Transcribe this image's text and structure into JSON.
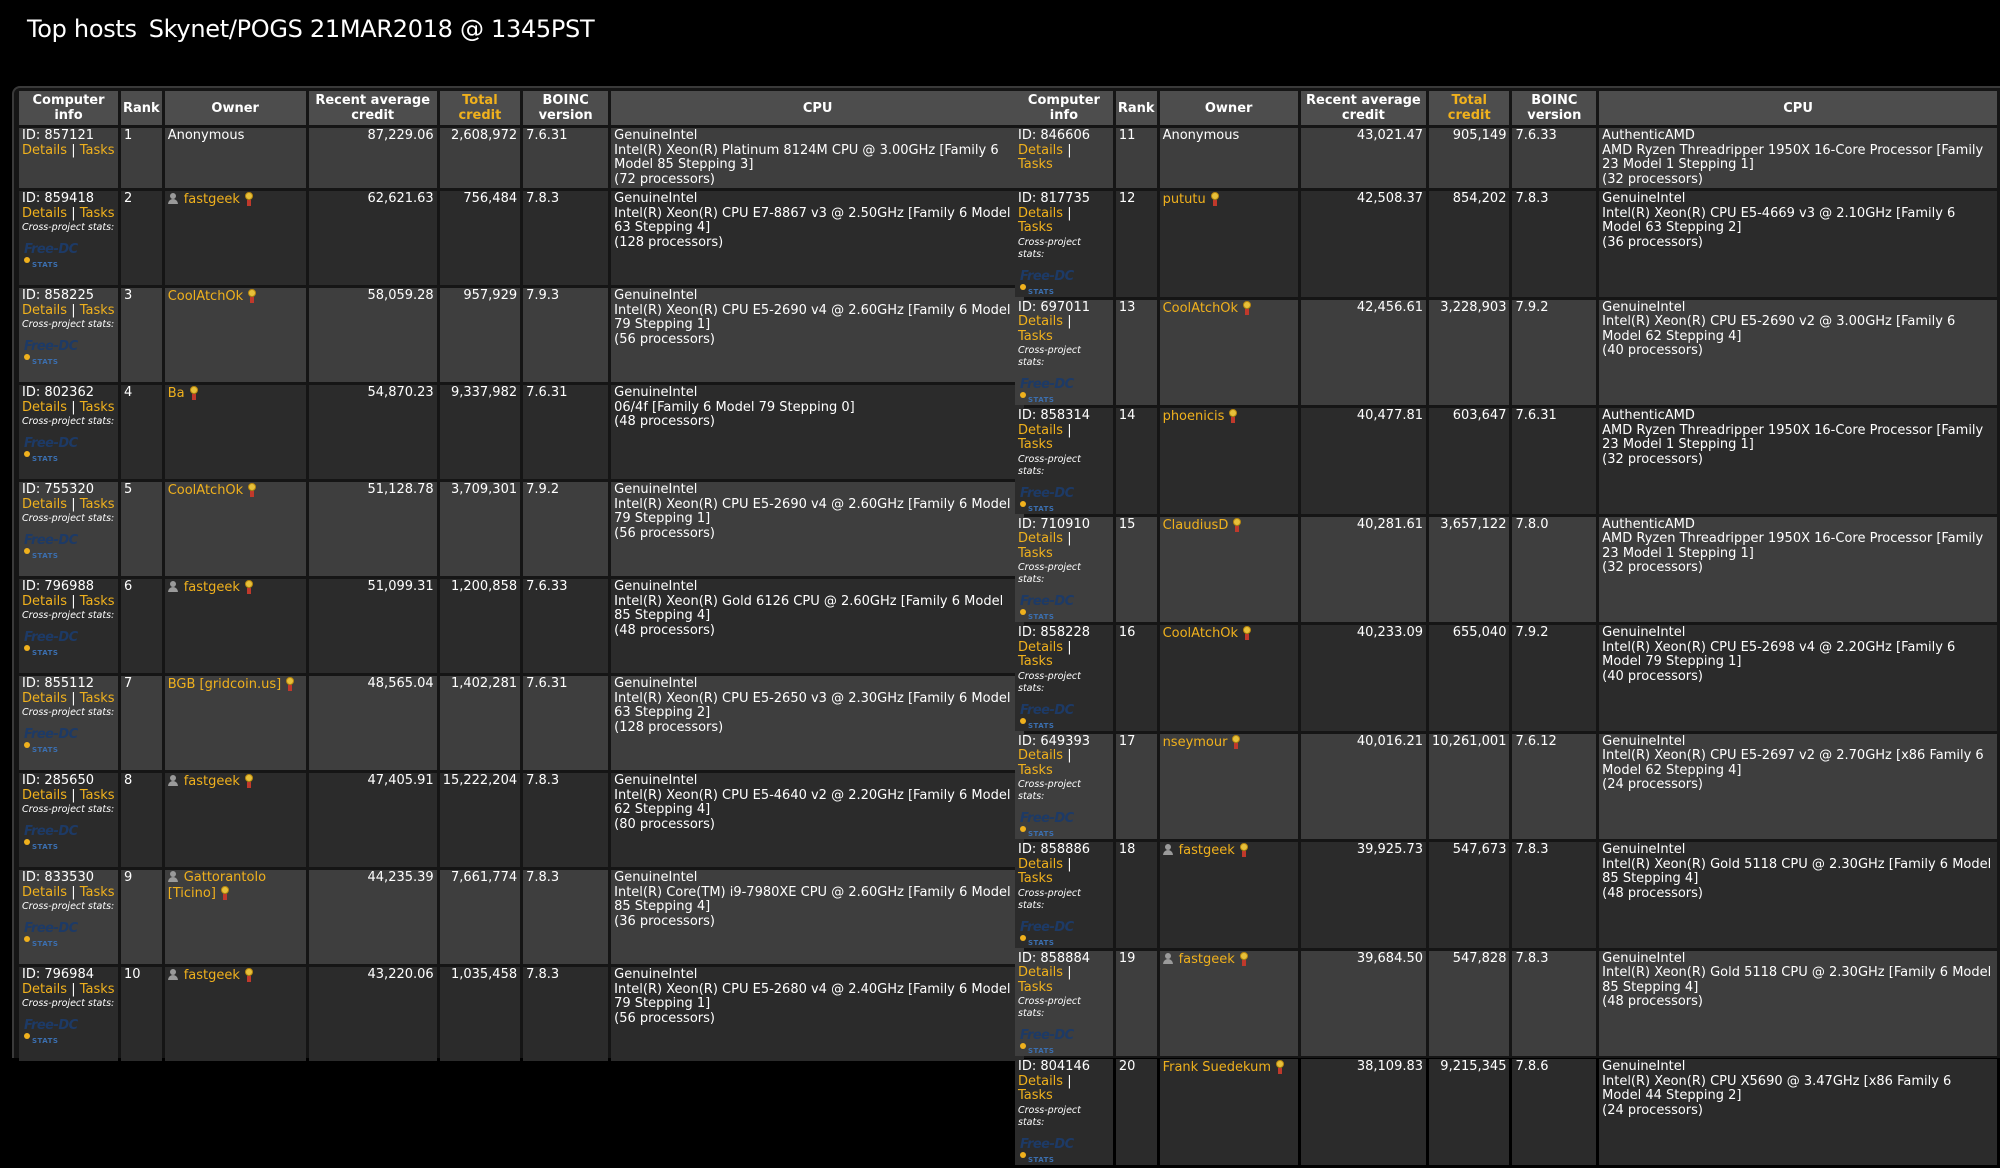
{
  "page": {
    "title": "Top hosts",
    "subtitle": "Skynet/POGS 21MAR2018 @ 1345PST"
  },
  "table": {
    "headers": [
      "Computer info",
      "Rank",
      "Owner",
      "Recent average credit",
      "Total credit",
      "BOINC version",
      "CPU"
    ],
    "details_label": "Details",
    "tasks_label": "Tasks",
    "cross_project_label": "Cross-project stats:",
    "logo_text": "Free-DC",
    "logo_sub": "STATS"
  },
  "colors": {
    "link": "#f0b11d",
    "header_bg": "#4d4d4d",
    "row_odd": "#3e3e3e",
    "row_even": "#2b2b2b"
  },
  "hosts_left": [
    {
      "id": "ID: 857121",
      "rank": "1",
      "owner": "Anonymous",
      "anon": true,
      "user_icon": false,
      "rac": "87,229.06",
      "total": "2,608,972",
      "boinc": "7.6.31",
      "cpu_vendor": "GenuineIntel",
      "cpu_model": "Intel(R) Xeon(R) Platinum 8124M CPU @ 3.00GHz [Family 6 Model 85 Stepping 3]",
      "procs": "(72 processors)"
    },
    {
      "id": "ID: 859418",
      "rank": "2",
      "owner": "fastgeek",
      "anon": false,
      "user_icon": true,
      "rac": "62,621.63",
      "total": "756,484",
      "boinc": "7.8.3",
      "cpu_vendor": "GenuineIntel",
      "cpu_model": "Intel(R) Xeon(R) CPU E7-8867 v3 @ 2.50GHz [Family 6 Model 63 Stepping 4]",
      "procs": "(128 processors)"
    },
    {
      "id": "ID: 858225",
      "rank": "3",
      "owner": "CoolAtchOk",
      "anon": false,
      "user_icon": false,
      "rac": "58,059.28",
      "total": "957,929",
      "boinc": "7.9.3",
      "cpu_vendor": "GenuineIntel",
      "cpu_model": "Intel(R) Xeon(R) CPU E5-2690 v4 @ 2.60GHz [Family 6 Model 79 Stepping 1]",
      "procs": "(56 processors)"
    },
    {
      "id": "ID: 802362",
      "rank": "4",
      "owner": "Ba",
      "anon": false,
      "user_icon": false,
      "rac": "54,870.23",
      "total": "9,337,982",
      "boinc": "7.6.31",
      "cpu_vendor": "GenuineIntel",
      "cpu_model": "06/4f [Family 6 Model 79 Stepping 0]",
      "procs": "(48 processors)"
    },
    {
      "id": "ID: 755320",
      "rank": "5",
      "owner": "CoolAtchOk",
      "anon": false,
      "user_icon": false,
      "rac": "51,128.78",
      "total": "3,709,301",
      "boinc": "7.9.2",
      "cpu_vendor": "GenuineIntel",
      "cpu_model": "Intel(R) Xeon(R) CPU E5-2690 v4 @ 2.60GHz [Family 6 Model 79 Stepping 1]",
      "procs": "(56 processors)"
    },
    {
      "id": "ID: 796988",
      "rank": "6",
      "owner": "fastgeek",
      "anon": false,
      "user_icon": true,
      "rac": "51,099.31",
      "total": "1,200,858",
      "boinc": "7.6.33",
      "cpu_vendor": "GenuineIntel",
      "cpu_model": "Intel(R) Xeon(R) Gold 6126 CPU @ 2.60GHz [Family 6 Model 85 Stepping 4]",
      "procs": "(48 processors)"
    },
    {
      "id": "ID: 855112",
      "rank": "7",
      "owner": "BGB [gridcoin.us]",
      "anon": false,
      "user_icon": false,
      "rac": "48,565.04",
      "total": "1,402,281",
      "boinc": "7.6.31",
      "cpu_vendor": "GenuineIntel",
      "cpu_model": "Intel(R) Xeon(R) CPU E5-2650 v3 @ 2.30GHz [Family 6 Model 63 Stepping 2]",
      "procs": "(128 processors)"
    },
    {
      "id": "ID: 285650",
      "rank": "8",
      "owner": "fastgeek",
      "anon": false,
      "user_icon": true,
      "rac": "47,405.91",
      "total": "15,222,204",
      "boinc": "7.8.3",
      "cpu_vendor": "GenuineIntel",
      "cpu_model": "Intel(R) Xeon(R) CPU E5-4640 v2 @ 2.20GHz [Family 6 Model 62 Stepping 4]",
      "procs": "(80 processors)"
    },
    {
      "id": "ID: 833530",
      "rank": "9",
      "owner": "Gattorantolo [Ticino]",
      "anon": false,
      "user_icon": true,
      "rac": "44,235.39",
      "total": "7,661,774",
      "boinc": "7.8.3",
      "cpu_vendor": "GenuineIntel",
      "cpu_model": "Intel(R) Core(TM) i9-7980XE CPU @ 2.60GHz [Family 6 Model 85 Stepping 4]",
      "procs": "(36 processors)"
    },
    {
      "id": "ID: 796984",
      "rank": "10",
      "owner": "fastgeek",
      "anon": false,
      "user_icon": true,
      "rac": "43,220.06",
      "total": "1,035,458",
      "boinc": "7.8.3",
      "cpu_vendor": "GenuineIntel",
      "cpu_model": "Intel(R) Xeon(R) CPU E5-2680 v4 @ 2.40GHz [Family 6 Model 79 Stepping 1]",
      "procs": "(56 processors)"
    }
  ],
  "hosts_right": [
    {
      "id": "ID: 846606",
      "rank": "11",
      "owner": "Anonymous",
      "anon": true,
      "user_icon": false,
      "rac": "43,021.47",
      "total": "905,149",
      "boinc": "7.6.33",
      "cpu_vendor": "AuthenticAMD",
      "cpu_model": "AMD Ryzen Threadripper 1950X 16-Core Processor [Family 23 Model 1 Stepping 1]",
      "procs": "(32 processors)"
    },
    {
      "id": "ID: 817735",
      "rank": "12",
      "owner": "pututu",
      "anon": false,
      "user_icon": false,
      "rac": "42,508.37",
      "total": "854,202",
      "boinc": "7.8.3",
      "cpu_vendor": "GenuineIntel",
      "cpu_model": "Intel(R) Xeon(R) CPU E5-4669 v3 @ 2.10GHz [Family 6 Model 63 Stepping 2]",
      "procs": "(36 processors)"
    },
    {
      "id": "ID: 697011",
      "rank": "13",
      "owner": "CoolAtchOk",
      "anon": false,
      "user_icon": false,
      "rac": "42,456.61",
      "total": "3,228,903",
      "boinc": "7.9.2",
      "cpu_vendor": "GenuineIntel",
      "cpu_model": "Intel(R) Xeon(R) CPU E5-2690 v2 @ 3.00GHz [Family 6 Model 62 Stepping 4]",
      "procs": "(40 processors)"
    },
    {
      "id": "ID: 858314",
      "rank": "14",
      "owner": "phoenicis",
      "anon": false,
      "user_icon": false,
      "rac": "40,477.81",
      "total": "603,647",
      "boinc": "7.6.31",
      "cpu_vendor": "AuthenticAMD",
      "cpu_model": "AMD Ryzen Threadripper 1950X 16-Core Processor [Family 23 Model 1 Stepping 1]",
      "procs": "(32 processors)"
    },
    {
      "id": "ID: 710910",
      "rank": "15",
      "owner": "ClaudiusD",
      "anon": false,
      "user_icon": false,
      "rac": "40,281.61",
      "total": "3,657,122",
      "boinc": "7.8.0",
      "cpu_vendor": "AuthenticAMD",
      "cpu_model": "AMD Ryzen Threadripper 1950X 16-Core Processor [Family 23 Model 1 Stepping 1]",
      "procs": "(32 processors)"
    },
    {
      "id": "ID: 858228",
      "rank": "16",
      "owner": "CoolAtchOk",
      "anon": false,
      "user_icon": false,
      "rac": "40,233.09",
      "total": "655,040",
      "boinc": "7.9.2",
      "cpu_vendor": "GenuineIntel",
      "cpu_model": "Intel(R) Xeon(R) CPU E5-2698 v4 @ 2.20GHz [Family 6 Model 79 Stepping 1]",
      "procs": "(40 processors)"
    },
    {
      "id": "ID: 649393",
      "rank": "17",
      "owner": "nseymour",
      "anon": false,
      "user_icon": false,
      "rac": "40,016.21",
      "total": "10,261,001",
      "boinc": "7.6.12",
      "cpu_vendor": "GenuineIntel",
      "cpu_model": "Intel(R) Xeon(R) CPU E5-2697 v2 @ 2.70GHz [x86 Family 6 Model 62 Stepping 4]",
      "procs": "(24 processors)"
    },
    {
      "id": "ID: 858886",
      "rank": "18",
      "owner": "fastgeek",
      "anon": false,
      "user_icon": true,
      "rac": "39,925.73",
      "total": "547,673",
      "boinc": "7.8.3",
      "cpu_vendor": "GenuineIntel",
      "cpu_model": "Intel(R) Xeon(R) Gold 5118 CPU @ 2.30GHz [Family 6 Model 85 Stepping 4]",
      "procs": "(48 processors)"
    },
    {
      "id": "ID: 858884",
      "rank": "19",
      "owner": "fastgeek",
      "anon": false,
      "user_icon": true,
      "rac": "39,684.50",
      "total": "547,828",
      "boinc": "7.8.3",
      "cpu_vendor": "GenuineIntel",
      "cpu_model": "Intel(R) Xeon(R) Gold 5118 CPU @ 2.30GHz [Family 6 Model 85 Stepping 4]",
      "procs": "(48 processors)"
    },
    {
      "id": "ID: 804146",
      "rank": "20",
      "owner": "Frank Suedekum",
      "anon": false,
      "user_icon": false,
      "rac": "38,109.83",
      "total": "9,215,345",
      "boinc": "7.8.6",
      "cpu_vendor": "GenuineIntel",
      "cpu_model": "Intel(R) Xeon(R) CPU X5690 @ 3.47GHz [x86 Family 6 Model 44 Stepping 2]",
      "procs": "(24 processors)"
    }
  ]
}
